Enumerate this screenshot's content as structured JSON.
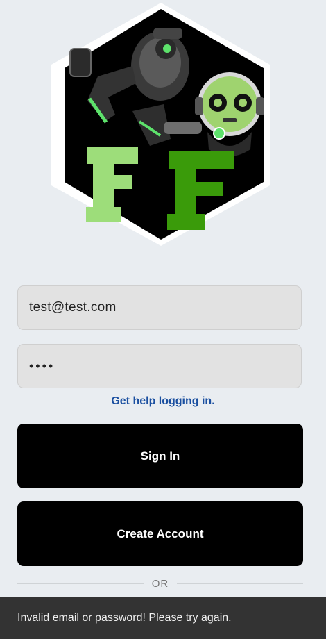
{
  "logo": {
    "name": "FF robots logo",
    "letters": [
      "F",
      "F"
    ],
    "colors": {
      "outline": "#ffffff",
      "hexagon": "#000000",
      "letter_left": "#9ddd7a",
      "letter_right": "#3a9b0a",
      "accent": "#5de26b"
    }
  },
  "form": {
    "email": {
      "value": "test@test.com",
      "type": "email"
    },
    "password": {
      "value": "••••",
      "type": "password"
    },
    "help_link": "Get help logging in.",
    "sign_in_label": "Sign In",
    "create_account_label": "Create Account",
    "divider_text": "OR"
  },
  "snackbar": {
    "message": "Invalid email or password! Please try again."
  },
  "colors": {
    "background": "#e9edf1",
    "link": "#1a4fa0",
    "button": "#000000",
    "snackbar": "#333333"
  }
}
